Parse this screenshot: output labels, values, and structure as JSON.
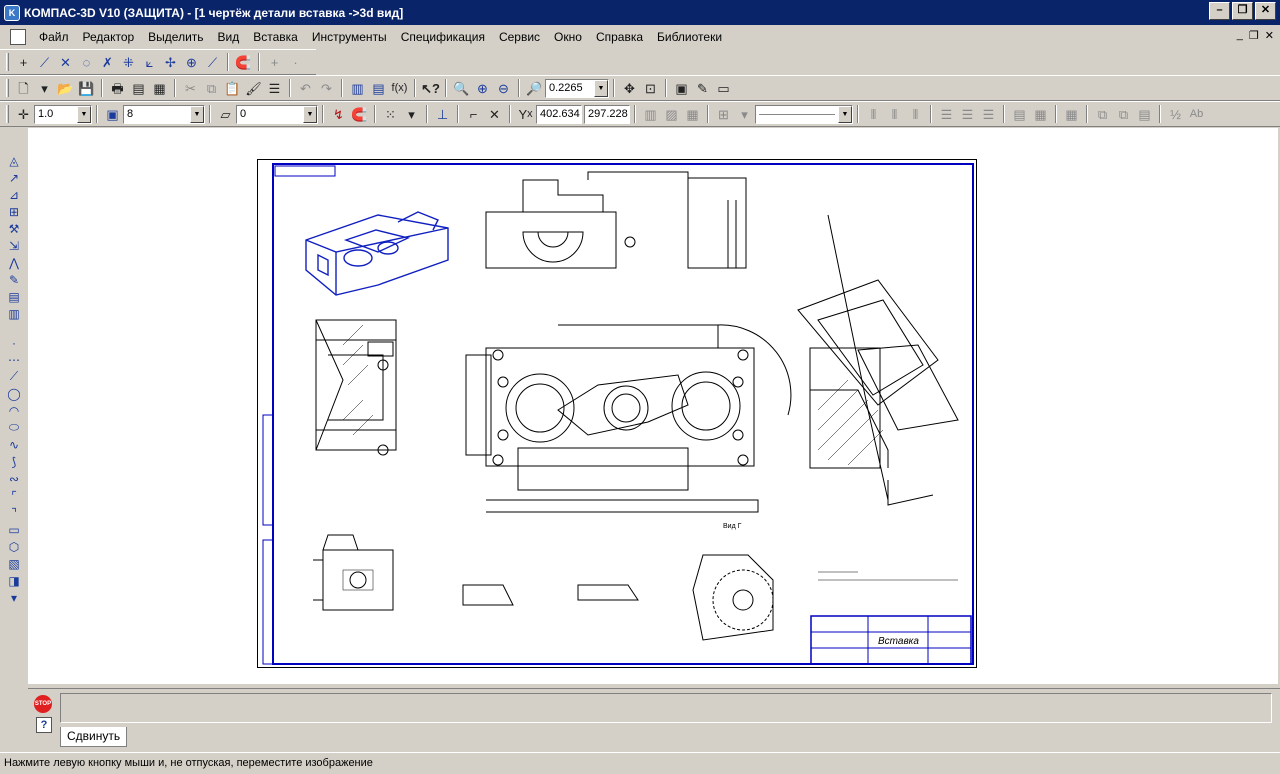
{
  "window": {
    "title": "КОМПАС-3D V10 (ЗАЩИТА) - [1 чертёж детали вставка ->3d вид]",
    "app_icon_text": "K"
  },
  "menu": {
    "items": [
      "Файл",
      "Редактор",
      "Выделить",
      "Вид",
      "Вставка",
      "Инструменты",
      "Спецификация",
      "Сервис",
      "Окно",
      "Справка",
      "Библиотеки"
    ]
  },
  "toolbar_standard": {
    "zoom_value": "0.2265"
  },
  "toolbar_current": {
    "step": "1.0",
    "layer": "8",
    "view": "0",
    "coord_x": "402.634",
    "coord_y": "297.228"
  },
  "command_panel": {
    "stop_label": "STOP",
    "help_label": "?",
    "tab_label": "Сдвинуть"
  },
  "status": {
    "hint": "Нажмите левую кнопку мыши и, не отпуская, переместите изображение"
  },
  "drawing": {
    "title_block_name": "Вставка",
    "view_label": "Вид Г"
  },
  "colors": {
    "titlebar": "#0a246a",
    "sheet_border": "#0000c0",
    "drawing_line": "#000000"
  }
}
